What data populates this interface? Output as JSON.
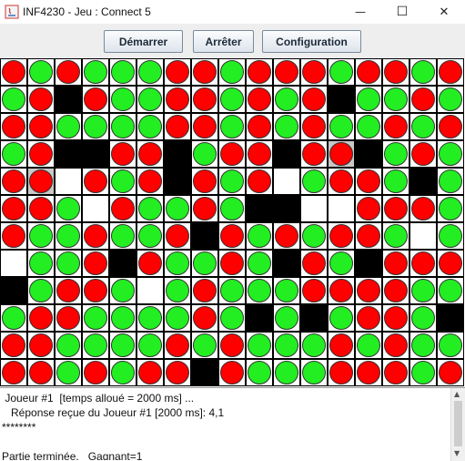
{
  "window": {
    "title": "INF4230 - Jeu : Connect 5",
    "minimize_glyph": "—",
    "maximize_glyph": "☐",
    "close_glyph": "✕"
  },
  "toolbar": {
    "start_label": "Démarrer",
    "stop_label": "Arrêter",
    "config_label": "Configuration"
  },
  "board": {
    "columns": 17,
    "rows_count": 12,
    "legend": "R=red piece, G=green piece, B=blocked, E=empty, H=highlighted",
    "rows": [
      "RGRGGGRRGRRRGRRGR",
      "GRBRGGRRGRGRBGGRG",
      "RRGGGGRRGRGRGGRGR",
      "GRBBRRBGRRBRHBGRG",
      "RHERGRBRGREGRRGBG",
      "RRGERGGRGBBEERRRG",
      "RGGRGGRBRGRGRRGEG",
      "EGGRBRGGRGBRGBRRR",
      "BGRRGEGRGGGRRRRGG",
      "GRRGGGGRGBGBGRRGB",
      "RRGGGGRGRGGGRGRGG",
      "RRGRGRRBRGGGRRRGR"
    ]
  },
  "log": {
    "lines": [
      " Joueur #1  [temps alloué = 2000 ms] ...",
      "   Réponse reçue du Joueur #1 [2000 ms]: 4,1",
      "********",
      "",
      "Partie terminée.   Gagnant=1"
    ]
  },
  "colors": {
    "red_piece": "#ff0000",
    "green_piece": "#22ee22",
    "blocked": "#000000",
    "highlight": "#c8c8c8"
  }
}
